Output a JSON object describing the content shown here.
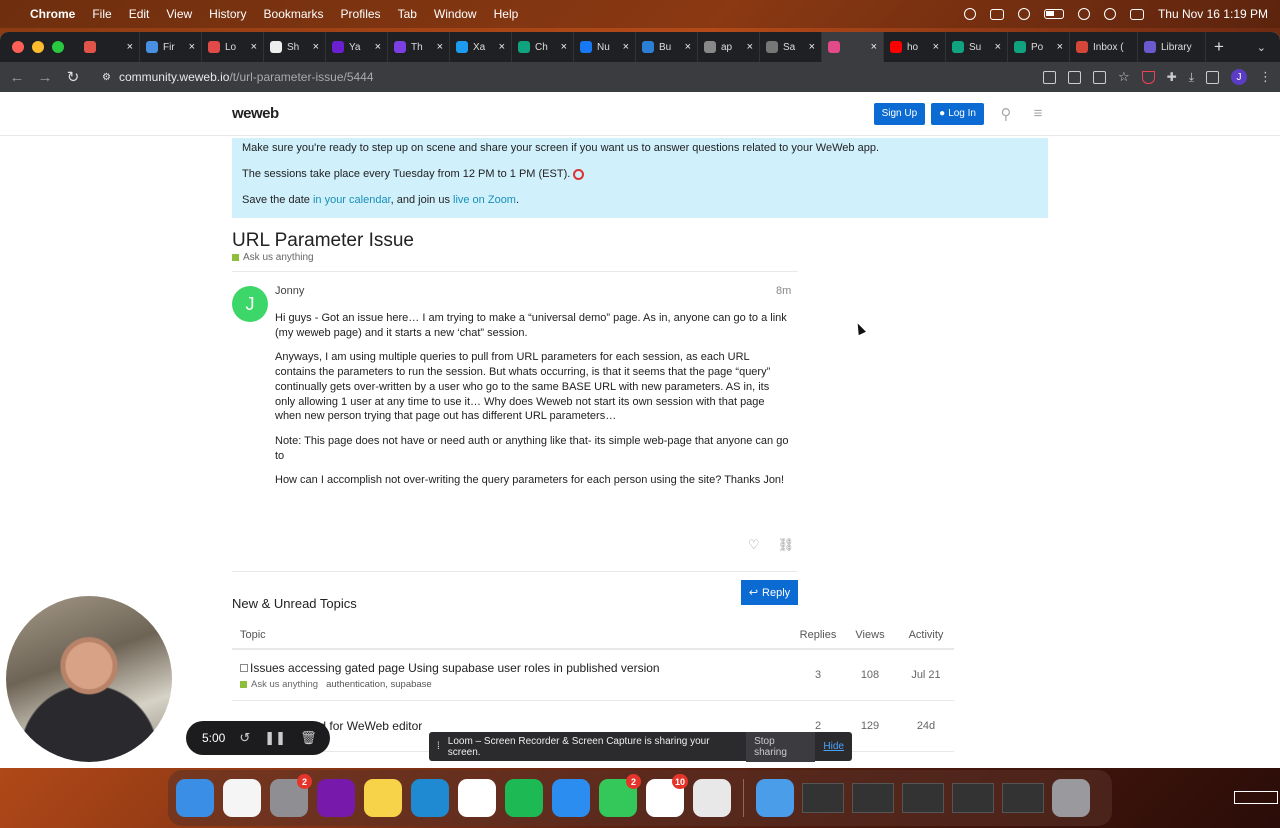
{
  "menubar": {
    "app_name": "Chrome",
    "items": [
      "File",
      "Edit",
      "View",
      "History",
      "Bookmarks",
      "Profiles",
      "Tab",
      "Window",
      "Help"
    ],
    "datetime": "Thu Nov 16  1:19 PM"
  },
  "browser": {
    "tabs": [
      {
        "label": "",
        "color": "#e0544a"
      },
      {
        "label": "Fir",
        "color": "#4a90e2"
      },
      {
        "label": "Lo",
        "color": "#e24a4a"
      },
      {
        "label": "Sh",
        "color": "#eeeeee"
      },
      {
        "label": "Ya",
        "color": "#6a1fd0"
      },
      {
        "label": "Th",
        "color": "#7b3fe4"
      },
      {
        "label": "Xa",
        "color": "#1d9bf0"
      },
      {
        "label": "Ch",
        "color": "#10a37f"
      },
      {
        "label": "Nu",
        "color": "#1877f2"
      },
      {
        "label": "Bu",
        "color": "#2b7fd4"
      },
      {
        "label": "ap",
        "color": "#888888"
      },
      {
        "label": "Sa",
        "color": "#777777"
      },
      {
        "label": "",
        "color": "#e24a8a"
      },
      {
        "label": "ho",
        "color": "#ff0000"
      },
      {
        "label": "Su",
        "color": "#10a37f"
      },
      {
        "label": "Po",
        "color": "#10a37f"
      },
      {
        "label": "Inbox (",
        "color": "#d44638"
      },
      {
        "label": "Library",
        "color": "#6a5acd"
      }
    ],
    "url_host": "community.weweb.io",
    "url_path": "/t/url-parameter-issue/5444",
    "profile_initial": "J"
  },
  "site": {
    "logo": "weweb",
    "signup_label": "Sign Up",
    "login_label": "Log In"
  },
  "banner": {
    "line1": "Make sure you're ready to step up on scene and share your screen if you want us to answer questions related to your WeWeb app.",
    "line2": "The sessions take place every Tuesday from 12 PM to 1 PM (EST).",
    "line3_pre": "Save the date ",
    "line3_link1": "in your calendar",
    "line3_mid": ", and join us ",
    "line3_link2": "live on Zoom",
    "line3_post": "."
  },
  "topic": {
    "title": "URL Parameter Issue",
    "category": "Ask us anything",
    "author": "Jonny",
    "avatar_initial": "J",
    "age": "8m",
    "paragraphs": [
      "Hi guys - Got an issue here… I am trying to make a “universal demo” page. As in, anyone can go to a link (my weweb page) and it starts a new ‘chat” session.",
      "Anyways, I am using multiple queries to pull from URL parameters for each session, as each URL contains the parameters to run the session. But whats occurring, is that it seems that the page “query” continually gets over-written by a user who go to the same BASE URL with new parameters. AS in, its only allowing 1 user at any time to use it… Why does Weweb not start its own session with that page when new person trying that page out has different URL parameters…",
      "Note: This page does not have or need auth or anything like that- its simple web-page that anyone can go to",
      "How can I accomplish not over-writing the query parameters for each person using the site? Thanks Jon!"
    ],
    "reply_label": "Reply"
  },
  "new_topics": {
    "heading": "New & Unread Topics",
    "columns": [
      "Topic",
      "Replies",
      "Views",
      "Activity"
    ],
    "rows": [
      {
        "title": "Issues accessing gated page Using supabase user roles in published version",
        "category": "Ask us anything",
        "tags": "authentication, supabase",
        "replies": "3",
        "views": "108",
        "activity": "Jul 21"
      },
      {
        "title": "Reset password for WeWeb editor",
        "category": "",
        "tags": "",
        "replies": "2",
        "views": "129",
        "activity": "24d"
      }
    ]
  },
  "loom": {
    "timer": "5:00",
    "share_message": "Loom – Screen Recorder & Screen Capture is sharing your screen.",
    "stop_label": "Stop sharing",
    "hide_label": "Hide"
  },
  "dock": {
    "apps": [
      {
        "name": "finder",
        "color": "#3a8ee6",
        "badge": ""
      },
      {
        "name": "freeform",
        "color": "#f5f5f5",
        "badge": ""
      },
      {
        "name": "system-settings",
        "color": "#8e8e93",
        "badge": "2"
      },
      {
        "name": "onenote",
        "color": "#7719aa",
        "badge": ""
      },
      {
        "name": "notes",
        "color": "#f7d34a",
        "badge": ""
      },
      {
        "name": "vscode",
        "color": "#1f8ad2",
        "badge": ""
      },
      {
        "name": "slack",
        "color": "#ffffff",
        "badge": ""
      },
      {
        "name": "spotify",
        "color": "#1db954",
        "badge": ""
      },
      {
        "name": "safari",
        "color": "#2b8df0",
        "badge": ""
      },
      {
        "name": "messages",
        "color": "#34c759",
        "badge": "2"
      },
      {
        "name": "clickup",
        "color": "#ffffff",
        "badge": "10"
      },
      {
        "name": "chrome",
        "color": "#e8e8e8",
        "badge": ""
      }
    ]
  }
}
